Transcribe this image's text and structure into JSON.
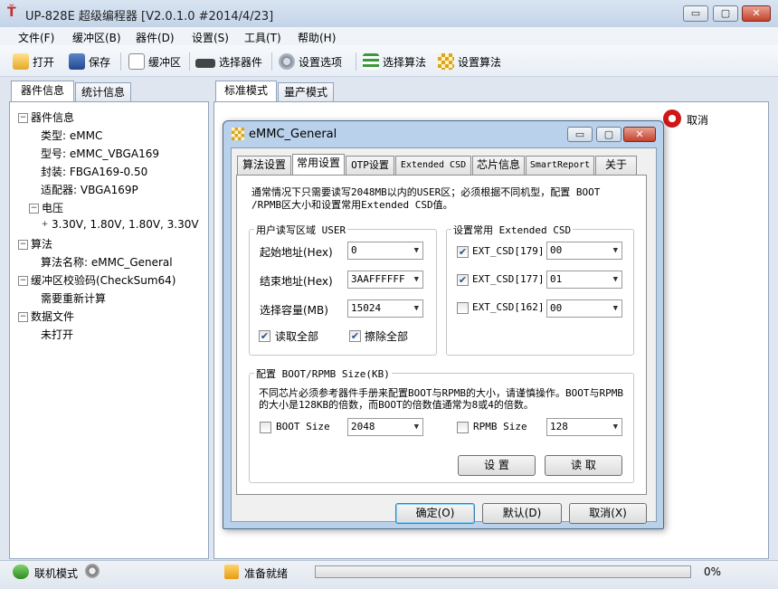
{
  "window": {
    "title": "UP-828E 超级编程器  [V2.0.1.0 #2014/4/23]",
    "icon": "app-logo-icon",
    "controls": {
      "minimize": "▭",
      "maximize": "▢",
      "close": "✕"
    }
  },
  "menubar": [
    "文件(F)",
    "缓冲区(B)",
    "器件(D)",
    "设置(S)",
    "工具(T)",
    "帮助(H)"
  ],
  "toolbar": {
    "open": "打开",
    "save": "保存",
    "buffer": "缓冲区",
    "select_device": "选择器件",
    "settings": "设置选项",
    "select_algorithm": "选择算法",
    "setup_algorithm": "设置算法"
  },
  "left_tabs": [
    "器件信息",
    "统计信息"
  ],
  "tree": {
    "device_info": "器件信息",
    "type": "类型: eMMC",
    "model": "型号: eMMC_VBGA169",
    "package": "封装: FBGA169-0.50",
    "adapter": "适配器: VBGA169P",
    "voltage": "电压",
    "voltage_values": "3.30V, 1.80V, 1.80V, 3.30V",
    "algorithm": "算法",
    "algorithm_name": "算法名称: eMMC_General",
    "checksum": "缓冲区校验码(CheckSum64)",
    "checksum_value": "需要重新计算",
    "data_file": "数据文件",
    "data_file_value": "未打开"
  },
  "right_tabs": [
    "标准模式",
    "量产模式"
  ],
  "inner_toolbar": {
    "cancel": "取消"
  },
  "dialog": {
    "title": "eMMC_General",
    "tabs": [
      "算法设置",
      "常用设置",
      "OTP设置",
      "Extended CSD",
      "芯片信息",
      "SmartReport",
      "关于"
    ],
    "active_tab": "常用设置",
    "note": "通常情况下只需要读写2048MB以内的USER区；必须根据不同机型，配置 BOOT /RPMB区大小和设置常用Extended CSD值。",
    "user_group": {
      "title": "用户读写区域 USER",
      "start_label": "起始地址(Hex)",
      "start_value": "0",
      "end_label": "结束地址(Hex)",
      "end_value": "3AAFFFFFF",
      "capacity_label": "选择容量(MB)",
      "capacity_value": "15024",
      "read_all": "读取全部",
      "read_all_checked": true,
      "erase_all": "擦除全部",
      "erase_all_checked": true
    },
    "csd_group": {
      "title": "设置常用 Extended CSD",
      "items": [
        {
          "label": "EXT_CSD[179]",
          "value": "00",
          "checked": true
        },
        {
          "label": "EXT_CSD[177]",
          "value": "01",
          "checked": true
        },
        {
          "label": "EXT_CSD[162]",
          "value": "00",
          "checked": false
        }
      ]
    },
    "boot_group": {
      "title": "配置 BOOT/RPMB Size(KB)",
      "note": "不同芯片必须参考器件手册来配置BOOT与RPMB的大小，请谨慎操作。BOOT与RPMB的大小是128KB的倍数，而BOOT的倍数值通常为8或4的倍数。",
      "boot_label": "BOOT Size",
      "boot_value": "2048",
      "boot_checked": false,
      "rpmb_label": "RPMB Size",
      "rpmb_value": "128",
      "rpmb_checked": false,
      "set_button": "设 置",
      "read_button": "读 取"
    },
    "ok": "确定(O)",
    "default": "默认(D)",
    "cancel": "取消(X)"
  },
  "statusbar": {
    "mode": "联机模式",
    "status": "准备就绪",
    "progress_percent": 0,
    "progress_text": "0%"
  }
}
